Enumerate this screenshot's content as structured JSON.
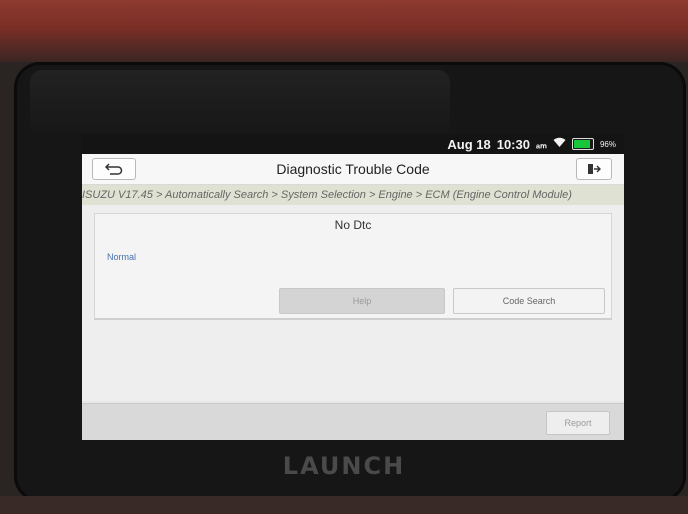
{
  "device": {
    "brand": "LAUNCH"
  },
  "status_bar": {
    "date": "Aug 18",
    "time": "10:30",
    "battery_percent": "96%",
    "battery_level": 0.96,
    "icons": [
      "am-icon",
      "wifi-icon",
      "battery-icon"
    ]
  },
  "header": {
    "title": "Diagnostic Trouble Code",
    "back_icon": "back-arrow-icon",
    "exit_icon": "exit-icon"
  },
  "breadcrumb": "ISUZU V17.45 > Automatically Search > System Selection > Engine > ECM (Engine Control Module)",
  "result": {
    "title": "No Dtc",
    "status": "Normal"
  },
  "buttons": {
    "help": "Help",
    "code_search": "Code Search",
    "report": "Report"
  },
  "colors": {
    "status_normal": "#4a6fb0",
    "battery": "#19c53a"
  }
}
